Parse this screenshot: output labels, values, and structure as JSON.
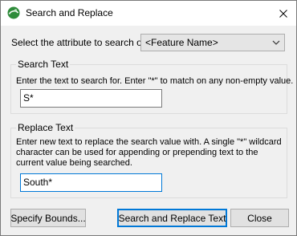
{
  "window": {
    "title": "Search and Replace",
    "icon": "globe-app-icon",
    "close_icon": "close-icon"
  },
  "attribute": {
    "label": "Select the attribute to search on:",
    "selected": "<Feature Name>"
  },
  "search": {
    "group_title": "Search Text",
    "description": "Enter the text to search for. Enter \"*\" to match on any non-empty value.",
    "value": "S*"
  },
  "replace": {
    "group_title": "Replace Text",
    "description_lines": [
      "Enter new text to replace the search value with. A single \"*\" wildcard",
      "character can be used for appending or prepending text to the",
      "current value being searched."
    ],
    "value": "South*"
  },
  "buttons": {
    "specify_bounds": "Specify Bounds...",
    "search_replace": "Search and Replace Text",
    "close": "Close"
  },
  "colors": {
    "accent": "#0078d7",
    "dialog_bg": "#f0f0f0"
  }
}
